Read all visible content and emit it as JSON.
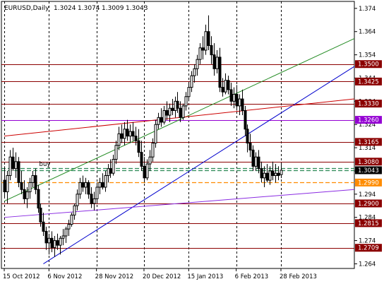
{
  "header": {
    "symbol": "EURUSD,Daily",
    "open": "1.3024",
    "high": "1.3074",
    "low": "1.3009",
    "close": "1.3043"
  },
  "chart_data": {
    "type": "candlestick",
    "symbol": "EURUSD",
    "timeframe": "Daily",
    "ylim": [
      1.262,
      1.377
    ],
    "y_ticks": [
      1.374,
      1.364,
      1.354,
      1.344,
      1.334,
      1.324,
      1.314,
      1.304,
      1.294,
      1.284,
      1.274,
      1.264
    ],
    "x_labels": [
      "15 Oct 2012",
      "6 Nov 2012",
      "28 Nov 2012",
      "20 Dec 2012",
      "15 Jan 2013",
      "6 Feb 2013",
      "28 Feb 2013"
    ],
    "vertical_dashed_lines_at": [
      "15 Oct 2012",
      "6 Nov 2012",
      "28 Nov 2012",
      "20 Dec 2012",
      "15 Jan 2013",
      "6 Feb 2013",
      "28 Feb 2013"
    ],
    "grid": false,
    "current_price": 1.3043,
    "horizontal_levels": [
      {
        "value": 1.35,
        "label": "1.3500",
        "color": "#8b0000",
        "style": "solid"
      },
      {
        "value": 1.3425,
        "label": "1.3425",
        "color": "#8b0000",
        "style": "solid"
      },
      {
        "value": 1.333,
        "label": "1.3330",
        "color": "#8b0000",
        "style": "solid"
      },
      {
        "value": 1.326,
        "label": "1.3260",
        "color": "#9400d3",
        "style": "solid"
      },
      {
        "value": 1.3165,
        "label": "1.3165",
        "color": "#8b0000",
        "style": "solid"
      },
      {
        "value": 1.308,
        "label": "1.3080",
        "color": "#8b0000",
        "style": "solid"
      },
      {
        "value": 1.3051,
        "label": "",
        "color": "#2e8b57",
        "style": "dashed"
      },
      {
        "value": 1.3043,
        "label": "",
        "color": "#2e8b57",
        "style": "dashed"
      },
      {
        "value": 1.299,
        "label": "1.2990",
        "color": "#ff8c00",
        "style": "dashed"
      },
      {
        "value": 1.29,
        "label": "1.2900",
        "color": "#8b0000",
        "style": "solid"
      },
      {
        "value": 1.2815,
        "label": "1.2815",
        "color": "#8b0000",
        "style": "solid"
      },
      {
        "value": 1.2709,
        "label": "1.2709",
        "color": "#8b0000",
        "style": "solid"
      }
    ],
    "trendlines": [
      {
        "color": "#228b22",
        "from": {
          "bar": 0,
          "price": 1.291
        },
        "to": {
          "bar": 99,
          "price": 1.361
        }
      },
      {
        "color": "#0000cd",
        "from": {
          "bar": 14,
          "price": 1.264
        },
        "to": {
          "bar": 99,
          "price": 1.349
        }
      },
      {
        "color": "#cc0000",
        "from": {
          "bar": 0,
          "price": 1.319
        },
        "to": {
          "bar": 99,
          "price": 1.335
        }
      },
      {
        "color": "#8a2be2",
        "from": {
          "bar": 0,
          "price": 1.284
        },
        "to": {
          "bar": 99,
          "price": 1.296
        }
      }
    ],
    "annotation": {
      "text": "buy",
      "bar": 11,
      "price": 1.307
    },
    "candles": [
      [
        1.3,
        1.306,
        1.293,
        1.295
      ],
      [
        1.295,
        1.304,
        1.29,
        1.302
      ],
      [
        1.302,
        1.313,
        1.3,
        1.31
      ],
      [
        1.31,
        1.314,
        1.304,
        1.305
      ],
      [
        1.305,
        1.312,
        1.301,
        1.308
      ],
      [
        1.308,
        1.31,
        1.297,
        1.299
      ],
      [
        1.299,
        1.304,
        1.294,
        1.296
      ],
      [
        1.296,
        1.3,
        1.29,
        1.292
      ],
      [
        1.292,
        1.297,
        1.288,
        1.295
      ],
      [
        1.295,
        1.301,
        1.292,
        1.299
      ],
      [
        1.299,
        1.304,
        1.297,
        1.302
      ],
      [
        1.302,
        1.305,
        1.294,
        1.296
      ],
      [
        1.296,
        1.298,
        1.286,
        1.288
      ],
      [
        1.288,
        1.29,
        1.28,
        1.282
      ],
      [
        1.282,
        1.286,
        1.276,
        1.278
      ],
      [
        1.278,
        1.28,
        1.27,
        1.273
      ],
      [
        1.273,
        1.277,
        1.268,
        1.275
      ],
      [
        1.275,
        1.278,
        1.269,
        1.271
      ],
      [
        1.271,
        1.276,
        1.267,
        1.274
      ],
      [
        1.274,
        1.277,
        1.27,
        1.272
      ],
      [
        1.272,
        1.276,
        1.268,
        1.275
      ],
      [
        1.275,
        1.279,
        1.272,
        1.276
      ],
      [
        1.276,
        1.28,
        1.273,
        1.279
      ],
      [
        1.279,
        1.283,
        1.276,
        1.281
      ],
      [
        1.281,
        1.286,
        1.28,
        1.285
      ],
      [
        1.285,
        1.29,
        1.283,
        1.289
      ],
      [
        1.289,
        1.296,
        1.287,
        1.294
      ],
      [
        1.294,
        1.301,
        1.292,
        1.299
      ],
      [
        1.299,
        1.302,
        1.295,
        1.297
      ],
      [
        1.297,
        1.301,
        1.294,
        1.299
      ],
      [
        1.299,
        1.3,
        1.292,
        1.294
      ],
      [
        1.294,
        1.297,
        1.288,
        1.29
      ],
      [
        1.29,
        1.295,
        1.287,
        1.292
      ],
      [
        1.292,
        1.299,
        1.29,
        1.297
      ],
      [
        1.297,
        1.301,
        1.294,
        1.299
      ],
      [
        1.299,
        1.303,
        1.296,
        1.297
      ],
      [
        1.297,
        1.304,
        1.295,
        1.302
      ],
      [
        1.302,
        1.307,
        1.299,
        1.305
      ],
      [
        1.305,
        1.309,
        1.301,
        1.303
      ],
      [
        1.303,
        1.311,
        1.302,
        1.309
      ],
      [
        1.309,
        1.317,
        1.307,
        1.315
      ],
      [
        1.315,
        1.323,
        1.313,
        1.32
      ],
      [
        1.32,
        1.324,
        1.316,
        1.318
      ],
      [
        1.318,
        1.325,
        1.315,
        1.322
      ],
      [
        1.322,
        1.326,
        1.317,
        1.319
      ],
      [
        1.319,
        1.324,
        1.316,
        1.321
      ],
      [
        1.321,
        1.325,
        1.317,
        1.319
      ],
      [
        1.319,
        1.323,
        1.315,
        1.317
      ],
      [
        1.317,
        1.322,
        1.31,
        1.312
      ],
      [
        1.312,
        1.317,
        1.304,
        1.306
      ],
      [
        1.306,
        1.31,
        1.299,
        1.301
      ],
      [
        1.301,
        1.309,
        1.3,
        1.307
      ],
      [
        1.307,
        1.313,
        1.304,
        1.31
      ],
      [
        1.31,
        1.318,
        1.308,
        1.316
      ],
      [
        1.316,
        1.326,
        1.314,
        1.324
      ],
      [
        1.324,
        1.329,
        1.322,
        1.327
      ],
      [
        1.327,
        1.331,
        1.323,
        1.325
      ],
      [
        1.325,
        1.332,
        1.324,
        1.33
      ],
      [
        1.33,
        1.334,
        1.326,
        1.328
      ],
      [
        1.328,
        1.333,
        1.325,
        1.331
      ],
      [
        1.331,
        1.335,
        1.328,
        1.33
      ],
      [
        1.33,
        1.336,
        1.327,
        1.334
      ],
      [
        1.334,
        1.338,
        1.329,
        1.331
      ],
      [
        1.331,
        1.334,
        1.325,
        1.327
      ],
      [
        1.327,
        1.333,
        1.326,
        1.332
      ],
      [
        1.332,
        1.338,
        1.33,
        1.336
      ],
      [
        1.336,
        1.342,
        1.334,
        1.34
      ],
      [
        1.34,
        1.347,
        1.338,
        1.345
      ],
      [
        1.345,
        1.35,
        1.342,
        1.348
      ],
      [
        1.348,
        1.354,
        1.345,
        1.352
      ],
      [
        1.352,
        1.359,
        1.35,
        1.357
      ],
      [
        1.357,
        1.362,
        1.352,
        1.356
      ],
      [
        1.356,
        1.367,
        1.354,
        1.364
      ],
      [
        1.364,
        1.371,
        1.356,
        1.358
      ],
      [
        1.358,
        1.362,
        1.35,
        1.354
      ],
      [
        1.354,
        1.359,
        1.345,
        1.348
      ],
      [
        1.348,
        1.356,
        1.346,
        1.353
      ],
      [
        1.353,
        1.357,
        1.338,
        1.34
      ],
      [
        1.34,
        1.344,
        1.336,
        1.338
      ],
      [
        1.338,
        1.346,
        1.337,
        1.343
      ],
      [
        1.343,
        1.345,
        1.337,
        1.339
      ],
      [
        1.339,
        1.342,
        1.332,
        1.334
      ],
      [
        1.334,
        1.34,
        1.331,
        1.337
      ],
      [
        1.337,
        1.341,
        1.33,
        1.332
      ],
      [
        1.332,
        1.337,
        1.328,
        1.335
      ],
      [
        1.335,
        1.339,
        1.328,
        1.33
      ],
      [
        1.33,
        1.332,
        1.319,
        1.322
      ],
      [
        1.322,
        1.324,
        1.312,
        1.316
      ],
      [
        1.316,
        1.32,
        1.31,
        1.313
      ],
      [
        1.313,
        1.315,
        1.304,
        1.306
      ],
      [
        1.306,
        1.312,
        1.304,
        1.31
      ],
      [
        1.31,
        1.313,
        1.303,
        1.305
      ],
      [
        1.305,
        1.308,
        1.299,
        1.301
      ],
      [
        1.301,
        1.306,
        1.297,
        1.303
      ],
      [
        1.303,
        1.307,
        1.299,
        1.3
      ],
      [
        1.3,
        1.306,
        1.298,
        1.304
      ],
      [
        1.304,
        1.308,
        1.3,
        1.302
      ],
      [
        1.302,
        1.307,
        1.299,
        1.303
      ],
      [
        1.303,
        1.306,
        1.3,
        1.302
      ],
      [
        1.3024,
        1.3074,
        1.3009,
        1.3043
      ]
    ]
  }
}
